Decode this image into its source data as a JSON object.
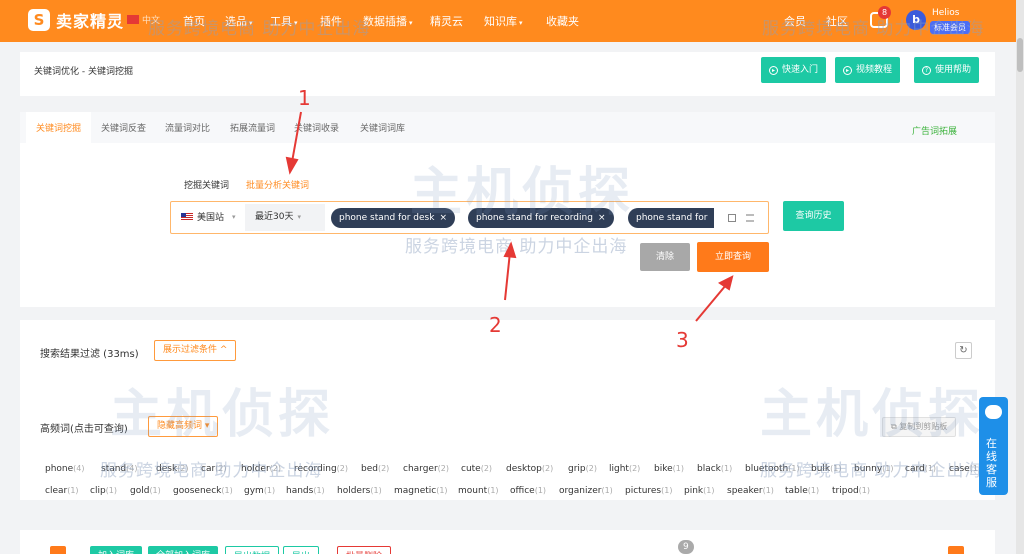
{
  "app": {
    "logo_text": "卖家精灵",
    "logo_mark": "S",
    "lang": "中文"
  },
  "nav": [
    {
      "label": "首页",
      "has_caret": false
    },
    {
      "label": "选品",
      "has_caret": true
    },
    {
      "label": "工具",
      "has_caret": true
    },
    {
      "label": "插件",
      "has_caret": false
    },
    {
      "label": "数据插播",
      "has_caret": true
    },
    {
      "label": "精灵云",
      "has_caret": false
    },
    {
      "label": "知识库",
      "has_caret": true
    },
    {
      "label": "收藏夹",
      "has_caret": false
    },
    {
      "label": "会员",
      "has_caret": false
    },
    {
      "label": "社区",
      "has_caret": false
    }
  ],
  "user": {
    "notifications": "8",
    "avatar_letter": "b",
    "name": "Helios",
    "level": "标准会员"
  },
  "breadcrumb": "关键词优化 - 关键词挖掘",
  "help_buttons": [
    "快速入门",
    "视频教程",
    "使用帮助"
  ],
  "tabs": [
    "关键词挖掘",
    "关键词反查",
    "流量词对比",
    "拓展流量词",
    "关键词收录",
    "关键词词库"
  ],
  "ad_link": "广告词拓展",
  "modes": [
    "挖掘关键词",
    "批量分析关键词"
  ],
  "search": {
    "site": "美国站",
    "period": "最近30天",
    "keywords": [
      "phone stand for desk",
      "phone stand for recording",
      "phone stand for"
    ]
  },
  "buttons": {
    "history": "查询历史",
    "clear": "清除",
    "query": "立即查询"
  },
  "filter": {
    "title": "搜索结果过滤 (33ms)",
    "toggle": "展示过滤条件",
    "caret": "^"
  },
  "high_freq": {
    "title": "高频词(点击可查询)",
    "hide": "隐藏高频词",
    "copy": "复制到剪贴板",
    "row1": [
      {
        "w": "phone",
        "c": "(4)"
      },
      {
        "w": "stand",
        "c": "(4)"
      },
      {
        "w": "desk",
        "c": "(2)"
      },
      {
        "w": "car",
        "c": "(2)"
      },
      {
        "w": "holder",
        "c": "(2)"
      },
      {
        "w": "recording",
        "c": "(2)"
      },
      {
        "w": "bed",
        "c": "(2)"
      },
      {
        "w": "charger",
        "c": "(2)"
      },
      {
        "w": "cute",
        "c": "(2)"
      },
      {
        "w": "desktop",
        "c": "(2)"
      },
      {
        "w": "grip",
        "c": "(2)"
      },
      {
        "w": "light",
        "c": "(2)"
      },
      {
        "w": "bike",
        "c": "(1)"
      },
      {
        "w": "black",
        "c": "(1)"
      },
      {
        "w": "bluetooth",
        "c": "(1)"
      },
      {
        "w": "bulk",
        "c": "(1)"
      },
      {
        "w": "bunny",
        "c": "(1)"
      },
      {
        "w": "card",
        "c": "(1)"
      },
      {
        "w": "case",
        "c": "(1)"
      }
    ],
    "row2": [
      {
        "w": "clear",
        "c": "(1)"
      },
      {
        "w": "clip",
        "c": "(1)"
      },
      {
        "w": "gold",
        "c": "(1)"
      },
      {
        "w": "gooseneck",
        "c": "(1)"
      },
      {
        "w": "gym",
        "c": "(1)"
      },
      {
        "w": "hands",
        "c": "(1)"
      },
      {
        "w": "holders",
        "c": "(1)"
      },
      {
        "w": "magnetic",
        "c": "(1)"
      },
      {
        "w": "mount",
        "c": "(1)"
      },
      {
        "w": "office",
        "c": "(1)"
      },
      {
        "w": "organizer",
        "c": "(1)"
      },
      {
        "w": "pictures",
        "c": "(1)"
      },
      {
        "w": "pink",
        "c": "(1)"
      },
      {
        "w": "speaker",
        "c": "(1)"
      },
      {
        "w": "table",
        "c": "(1)"
      },
      {
        "w": "tripod",
        "c": "(1)"
      }
    ]
  },
  "bottom_actions": [
    "加入词库",
    "全部加入词库",
    "导出数据",
    "导出",
    "批量删除"
  ],
  "bottom_badge": "9",
  "annotations": [
    "1",
    "2",
    "3"
  ],
  "watermark": {
    "slogan": "服务跨境电商 助力中企出海",
    "brand": "主机侦探"
  },
  "chat": {
    "label": "在线客服"
  },
  "colors": {
    "brand": "#ff8a1e",
    "teal": "#1dc9a4",
    "dark_chip": "#2f3e57",
    "annotation": "#e53935"
  }
}
